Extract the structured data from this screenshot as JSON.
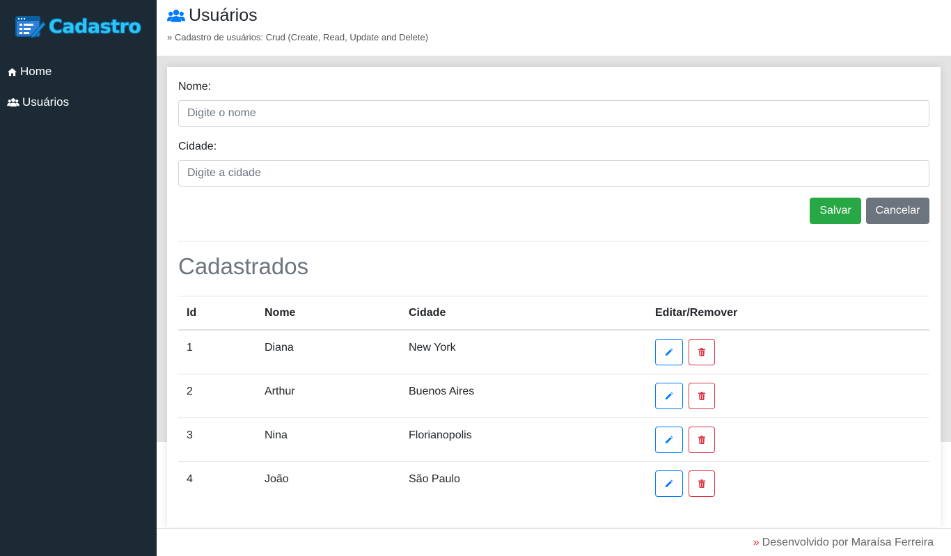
{
  "brand": {
    "name": "Cadastro"
  },
  "sidebar": {
    "items": [
      {
        "label": "Home",
        "icon": "home-icon"
      },
      {
        "label": "Usuários",
        "icon": "users-icon"
      }
    ]
  },
  "header": {
    "title": "Usuários",
    "subtitle_marker": "»",
    "subtitle": "Cadastro de usuários: Crud (Create, Read, Update and Delete)"
  },
  "form": {
    "nome_label": "Nome:",
    "nome_placeholder": "Digite o nome",
    "nome_value": "",
    "cidade_label": "Cidade:",
    "cidade_placeholder": "Digite a cidade",
    "cidade_value": "",
    "save_label": "Salvar",
    "cancel_label": "Cancelar"
  },
  "list": {
    "title": "Cadastrados",
    "columns": [
      "Id",
      "Nome",
      "Cidade",
      "Editar/Remover"
    ],
    "rows": [
      {
        "id": "1",
        "nome": "Diana",
        "cidade": "New York"
      },
      {
        "id": "2",
        "nome": "Arthur",
        "cidade": "Buenos Aires"
      },
      {
        "id": "3",
        "nome": "Nina",
        "cidade": "Florianopolis"
      },
      {
        "id": "4",
        "nome": "João",
        "cidade": "São Paulo"
      }
    ]
  },
  "footer": {
    "marker": "»",
    "text": "Desenvolvido por Maraísa Ferreira"
  },
  "colors": {
    "sidebar_bg": "#1b2a35",
    "accent_blue": "#007bff",
    "save_green": "#28a745",
    "cancel_gray": "#6c757d",
    "danger_red": "#dc3545"
  }
}
